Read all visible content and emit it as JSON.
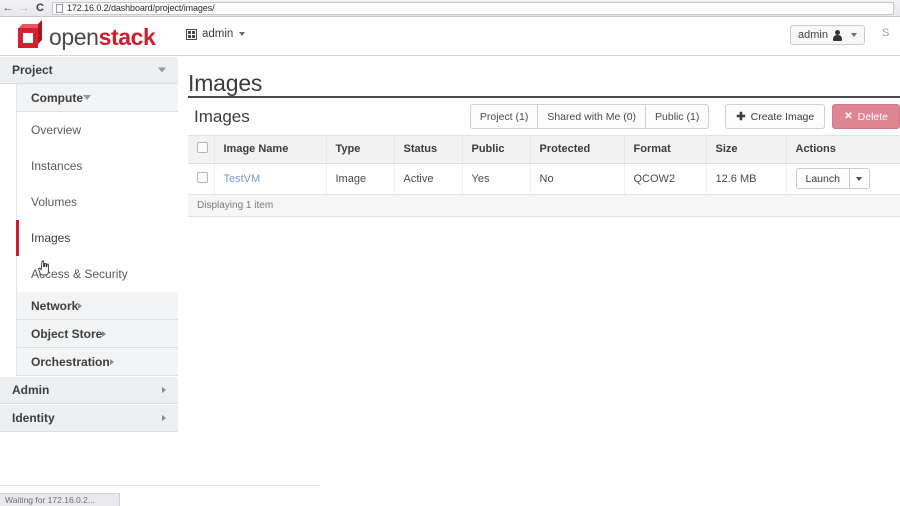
{
  "browser": {
    "url": "172.16.0.2/dashboard/project/images/",
    "back_icon": "back-arrow-icon",
    "forward_icon": "forward-arrow-icon",
    "reload_icon": "C",
    "status_text": "Waiting for 172.16.0.2..."
  },
  "topbar": {
    "brand_open": "open",
    "brand_stack": "stack",
    "project_switcher_label": "admin",
    "user_menu_label": "admin",
    "right_cut_label": "S"
  },
  "sidebar": {
    "groups": [
      {
        "label": "Project",
        "state": "expanded"
      },
      {
        "label": "Admin",
        "state": "collapsed"
      },
      {
        "label": "Identity",
        "state": "collapsed"
      }
    ],
    "compute": {
      "label": "Compute",
      "state": "expanded"
    },
    "compute_items": [
      {
        "label": "Overview",
        "active": false
      },
      {
        "label": "Instances",
        "active": false
      },
      {
        "label": "Volumes",
        "active": false
      },
      {
        "label": "Images",
        "active": true
      },
      {
        "label": "Access & Security",
        "active": false
      }
    ],
    "sub_groups": [
      {
        "label": "Network"
      },
      {
        "label": "Object Store"
      },
      {
        "label": "Orchestration"
      }
    ]
  },
  "page": {
    "title": "Images",
    "panel_title": "Images"
  },
  "toolbar": {
    "filters": [
      {
        "label": "Project (1)",
        "active": true
      },
      {
        "label": "Shared with Me (0)",
        "active": false
      },
      {
        "label": "Public (1)",
        "active": false
      }
    ],
    "create_label": "Create Image",
    "create_glyph": "✚",
    "delete_label": "Delete",
    "delete_glyph": "✕",
    "delete_color": "#dd8593"
  },
  "table": {
    "columns": [
      "Image Name",
      "Type",
      "Status",
      "Public",
      "Protected",
      "Format",
      "Size",
      "Actions"
    ],
    "rows": [
      {
        "name": "TestVM",
        "type": "Image",
        "status": "Active",
        "public": "Yes",
        "protected": "No",
        "format": "QCOW2",
        "size": "12.6 MB",
        "action_label": "Launch"
      }
    ],
    "footer": "Displaying 1 item"
  }
}
